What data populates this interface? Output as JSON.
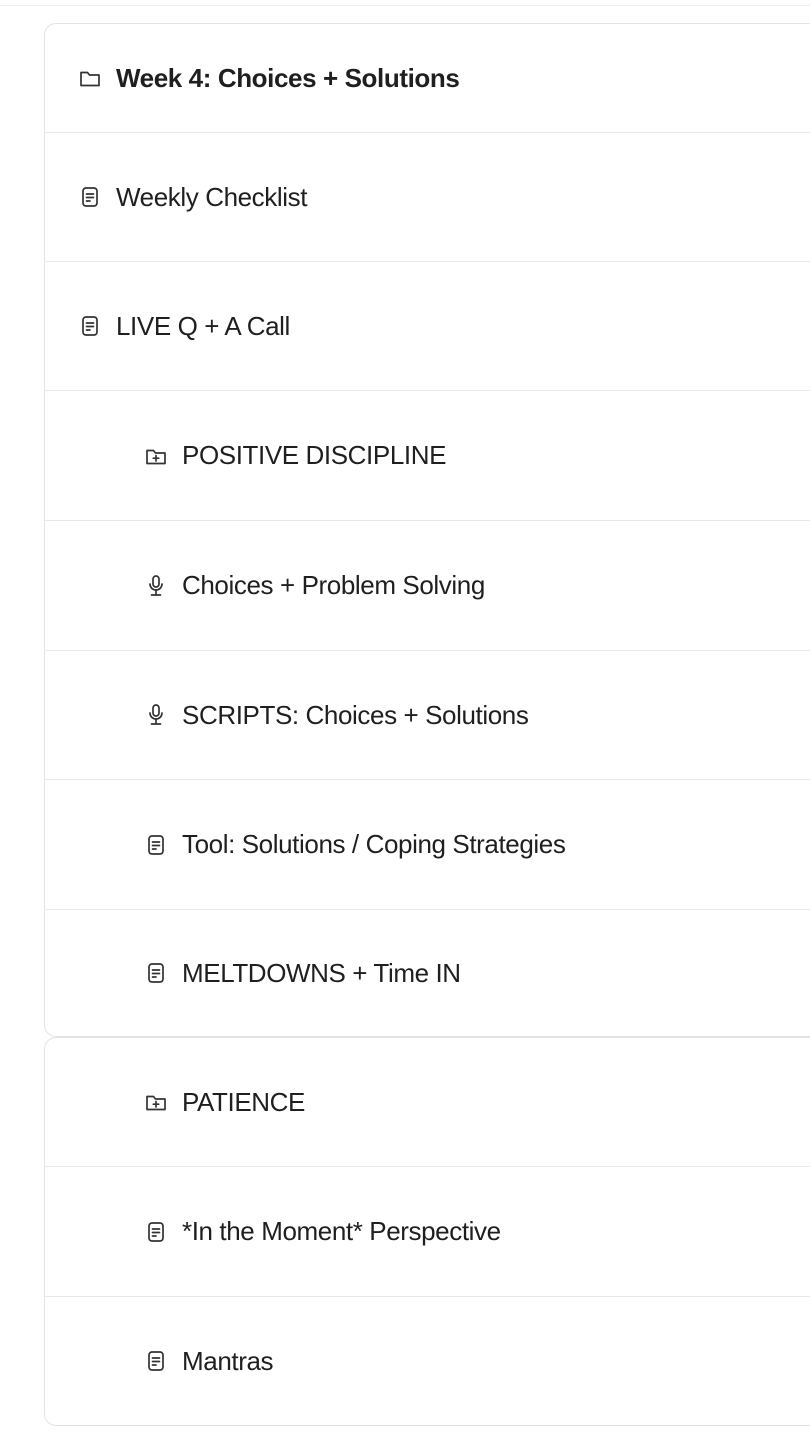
{
  "module": {
    "title": "Week 4: Choices + Solutions",
    "icon": "folder-icon"
  },
  "items": [
    {
      "label": "Weekly Checklist",
      "icon": "document-icon"
    },
    {
      "label": "LIVE Q + A Call",
      "icon": "document-icon"
    },
    {
      "label": "POSITIVE DISCIPLINE",
      "icon": "folder-plus-icon"
    },
    {
      "label": "Choices + Problem Solving",
      "icon": "microphone-icon"
    },
    {
      "label": "SCRIPTS: Choices + Solutions",
      "icon": "microphone-icon"
    },
    {
      "label": "Tool: Solutions / Coping Strategies",
      "icon": "document-icon"
    },
    {
      "label": "MELTDOWNS + Time IN",
      "icon": "document-icon"
    },
    {
      "label": "PATIENCE",
      "icon": "folder-plus-icon"
    },
    {
      "label": "*In the Moment* Perspective",
      "icon": "document-icon"
    },
    {
      "label": "Mantras",
      "icon": "document-icon"
    }
  ]
}
